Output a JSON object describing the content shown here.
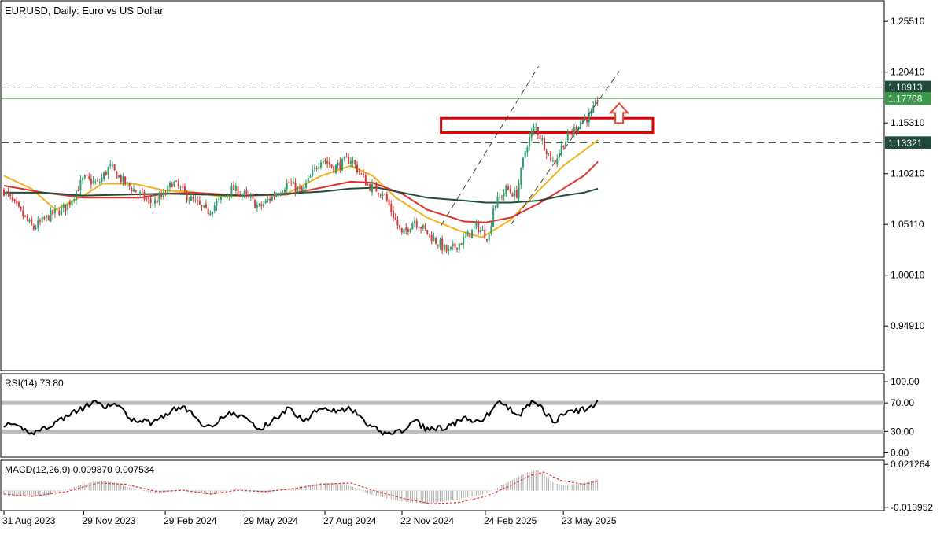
{
  "colors": {
    "background": "#ffffff",
    "frame": "#000000",
    "candle_up": "#2e9e6e",
    "candle_down": "#d43a3a",
    "ma_fast": "#f5b21a",
    "ma_mid": "#e03030",
    "ma_slow": "#1f4b3a",
    "price_line": "#3a9a4a",
    "level_line": "#1f4b3a",
    "channel": "#444444",
    "zone": "#e00000",
    "arrow": "#e04830",
    "rsi_line": "#000000",
    "rsi_band": "#bdbdbd",
    "macd_hist": "#a8a8a8",
    "macd_signal": "#d43a3a",
    "badge_price": "#3a9a4a",
    "badge_level": "#1f4b3a"
  },
  "chart_data": [
    {
      "type": "candlestick",
      "title": "EURUSD, Daily:  Euro vs US Dollar",
      "ylim": [
        0.905,
        1.275
      ],
      "y_ticks": [
        "1.25510",
        "1.20410",
        "1.15310",
        "1.10210",
        "1.05110",
        "1.00010",
        "0.94910"
      ],
      "x_ticks": [
        "31 Aug 2023",
        "29 Nov 2023",
        "29 Feb 2024",
        "29 May 2024",
        "27 Aug 2024",
        "22 Nov 2024",
        "24 Feb 2025",
        "23 May 2025"
      ],
      "close_path": [
        [
          "2023-08-31",
          1.085
        ],
        [
          "2023-09-15",
          1.067
        ],
        [
          "2023-10-03",
          1.047
        ],
        [
          "2023-10-20",
          1.059
        ],
        [
          "2023-11-10",
          1.069
        ],
        [
          "2023-11-29",
          1.097
        ],
        [
          "2023-12-15",
          1.092
        ],
        [
          "2023-12-28",
          1.109
        ],
        [
          "2024-01-15",
          1.092
        ],
        [
          "2024-02-14",
          1.072
        ],
        [
          "2024-02-29",
          1.081
        ],
        [
          "2024-03-08",
          1.094
        ],
        [
          "2024-03-28",
          1.077
        ],
        [
          "2024-04-16",
          1.063
        ],
        [
          "2024-05-15",
          1.087
        ],
        [
          "2024-05-29",
          1.08
        ],
        [
          "2024-06-14",
          1.068
        ],
        [
          "2024-07-17",
          1.093
        ],
        [
          "2024-08-01",
          1.083
        ],
        [
          "2024-08-23",
          1.118
        ],
        [
          "2024-09-06",
          1.108
        ],
        [
          "2024-09-25",
          1.117
        ],
        [
          "2024-10-15",
          1.09
        ],
        [
          "2024-11-01",
          1.083
        ],
        [
          "2024-11-22",
          1.04
        ],
        [
          "2024-12-06",
          1.056
        ],
        [
          "2024-12-20",
          1.043
        ],
        [
          "2025-01-13",
          1.023
        ],
        [
          "2025-01-31",
          1.036
        ],
        [
          "2025-02-14",
          1.049
        ],
        [
          "2025-02-28",
          1.038
        ],
        [
          "2025-03-05",
          1.069
        ],
        [
          "2025-03-20",
          1.087
        ],
        [
          "2025-03-31",
          1.08
        ],
        [
          "2025-04-11",
          1.13
        ],
        [
          "2025-04-21",
          1.15
        ],
        [
          "2025-05-12",
          1.112
        ],
        [
          "2025-05-23",
          1.133
        ],
        [
          "2025-06-12",
          1.155
        ],
        [
          "2025-06-24",
          1.161
        ],
        [
          "2025-07-01",
          1.178
        ]
      ],
      "moving_averages": [
        {
          "role": "ma_fast",
          "path": [
            [
              "2023-08-31",
              1.1
            ],
            [
              "2023-10-01",
              1.087
            ],
            [
              "2023-10-28",
              1.066
            ],
            [
              "2023-11-29",
              1.08
            ],
            [
              "2023-12-20",
              1.092
            ],
            [
              "2024-01-25",
              1.092
            ],
            [
              "2024-02-29",
              1.085
            ],
            [
              "2024-03-28",
              1.084
            ],
            [
              "2024-05-01",
              1.079
            ],
            [
              "2024-05-29",
              1.08
            ],
            [
              "2024-07-15",
              1.082
            ],
            [
              "2024-08-23",
              1.1
            ],
            [
              "2024-09-25",
              1.11
            ],
            [
              "2024-10-20",
              1.1
            ],
            [
              "2024-11-15",
              1.078
            ],
            [
              "2024-12-20",
              1.058
            ],
            [
              "2025-01-25",
              1.045
            ],
            [
              "2025-02-20",
              1.038
            ],
            [
              "2025-03-25",
              1.056
            ],
            [
              "2025-04-25",
              1.085
            ],
            [
              "2025-05-23",
              1.11
            ],
            [
              "2025-06-15",
              1.125
            ],
            [
              "2025-07-01",
              1.136
            ]
          ]
        },
        {
          "role": "ma_mid",
          "path": [
            [
              "2023-08-31",
              1.09
            ],
            [
              "2023-10-15",
              1.083
            ],
            [
              "2023-11-29",
              1.078
            ],
            [
              "2024-02-01",
              1.078
            ],
            [
              "2024-02-29",
              1.082
            ],
            [
              "2024-04-01",
              1.083
            ],
            [
              "2024-05-29",
              1.08
            ],
            [
              "2024-07-15",
              1.081
            ],
            [
              "2024-08-23",
              1.088
            ],
            [
              "2024-09-25",
              1.094
            ],
            [
              "2024-10-20",
              1.093
            ],
            [
              "2024-11-22",
              1.082
            ],
            [
              "2024-12-20",
              1.066
            ],
            [
              "2025-01-31",
              1.054
            ],
            [
              "2025-02-24",
              1.053
            ],
            [
              "2025-03-25",
              1.058
            ],
            [
              "2025-04-25",
              1.072
            ],
            [
              "2025-05-23",
              1.087
            ],
            [
              "2025-06-15",
              1.1
            ],
            [
              "2025-07-01",
              1.114
            ]
          ]
        },
        {
          "role": "ma_slow",
          "path": [
            [
              "2023-08-31",
              1.083
            ],
            [
              "2023-10-15",
              1.083
            ],
            [
              "2023-11-29",
              1.08
            ],
            [
              "2024-01-15",
              1.081
            ],
            [
              "2024-02-29",
              1.082
            ],
            [
              "2024-04-15",
              1.081
            ],
            [
              "2024-05-29",
              1.08
            ],
            [
              "2024-07-15",
              1.082
            ],
            [
              "2024-08-23",
              1.084
            ],
            [
              "2024-09-25",
              1.087
            ],
            [
              "2024-10-25",
              1.088
            ],
            [
              "2024-11-22",
              1.083
            ],
            [
              "2024-12-20",
              1.078
            ],
            [
              "2025-01-31",
              1.075
            ],
            [
              "2025-02-24",
              1.073
            ],
            [
              "2025-03-25",
              1.073
            ],
            [
              "2025-04-25",
              1.075
            ],
            [
              "2025-05-23",
              1.08
            ],
            [
              "2025-06-15",
              1.083
            ],
            [
              "2025-07-01",
              1.087
            ]
          ]
        }
      ],
      "levels": [
        {
          "role": "upper",
          "value": 1.18913,
          "label": "1.18913",
          "style": "dashed"
        },
        {
          "role": "price",
          "value": 1.17768,
          "label": "1.17768",
          "style": "solid"
        },
        {
          "role": "lower",
          "value": 1.13321,
          "label": "1.13321",
          "style": "dashed"
        }
      ],
      "zone": {
        "from": "2025-01-05",
        "to": "2025-09-01",
        "low": 1.1434,
        "high": 1.1578
      },
      "arrow": {
        "date": "2025-07-25",
        "value": 1.153,
        "direction": "up"
      },
      "channel_lines": [
        [
          [
            "2025-01-05",
            1.05
          ],
          [
            "2025-04-25",
            1.21
          ]
        ],
        [
          [
            "2025-03-25",
            1.051
          ],
          [
            "2025-07-25",
            1.205
          ]
        ]
      ]
    },
    {
      "type": "line",
      "title": "RSI(14) 73.80",
      "ylim": [
        -5,
        110
      ],
      "y_ticks": [
        "100.00",
        "70.00",
        "30.00",
        "0.00"
      ],
      "bands": [
        70,
        30
      ],
      "path": [
        [
          "2023-08-31",
          40
        ],
        [
          "2023-09-20",
          34
        ],
        [
          "2023-10-03",
          28
        ],
        [
          "2023-10-25",
          40
        ],
        [
          "2023-11-10",
          52
        ],
        [
          "2023-11-29",
          63
        ],
        [
          "2023-12-10",
          72
        ],
        [
          "2023-12-20",
          64
        ],
        [
          "2024-01-05",
          68
        ],
        [
          "2024-01-20",
          48
        ],
        [
          "2024-02-14",
          42
        ],
        [
          "2024-03-08",
          60
        ],
        [
          "2024-03-20",
          65
        ],
        [
          "2024-04-16",
          35
        ],
        [
          "2024-05-10",
          55
        ],
        [
          "2024-05-29",
          50
        ],
        [
          "2024-06-14",
          32
        ],
        [
          "2024-07-17",
          62
        ],
        [
          "2024-08-05",
          45
        ],
        [
          "2024-08-23",
          66
        ],
        [
          "2024-09-10",
          58
        ],
        [
          "2024-09-25",
          62
        ],
        [
          "2024-10-15",
          38
        ],
        [
          "2024-11-01",
          28
        ],
        [
          "2024-11-22",
          30
        ],
        [
          "2024-12-06",
          45
        ],
        [
          "2024-12-20",
          33
        ],
        [
          "2025-01-13",
          36
        ],
        [
          "2025-01-31",
          48
        ],
        [
          "2025-02-14",
          42
        ],
        [
          "2025-03-01",
          55
        ],
        [
          "2025-03-10",
          73
        ],
        [
          "2025-03-25",
          60
        ],
        [
          "2025-04-05",
          55
        ],
        [
          "2025-04-21",
          75
        ],
        [
          "2025-05-12",
          42
        ],
        [
          "2025-05-25",
          56
        ],
        [
          "2025-06-12",
          60
        ],
        [
          "2025-06-24",
          64
        ],
        [
          "2025-07-01",
          74
        ]
      ]
    },
    {
      "type": "bar",
      "title": "MACD(12,26,9) 0.009870 0.007534",
      "ylim": [
        -0.016,
        0.024
      ],
      "y_ticks": [
        "0.021264",
        "-0.013952"
      ],
      "histogram": [
        [
          "2023-08-31",
          -0.004
        ],
        [
          "2023-09-25",
          -0.005
        ],
        [
          "2023-10-20",
          -0.004
        ],
        [
          "2023-11-15",
          0.002
        ],
        [
          "2023-12-10",
          0.007
        ],
        [
          "2023-12-25",
          0.008
        ],
        [
          "2024-01-25",
          0.001
        ],
        [
          "2024-02-20",
          -0.003
        ],
        [
          "2024-03-20",
          0.001
        ],
        [
          "2024-04-20",
          -0.004
        ],
        [
          "2024-05-20",
          0.002
        ],
        [
          "2024-06-20",
          -0.002
        ],
        [
          "2024-07-20",
          0.002
        ],
        [
          "2024-08-23",
          0.006
        ],
        [
          "2024-09-20",
          0.005
        ],
        [
          "2024-10-20",
          -0.004
        ],
        [
          "2024-11-20",
          -0.009
        ],
        [
          "2024-12-20",
          -0.011
        ],
        [
          "2025-01-20",
          -0.008
        ],
        [
          "2025-02-24",
          -0.003
        ],
        [
          "2025-03-20",
          0.006
        ],
        [
          "2025-04-10",
          0.014
        ],
        [
          "2025-04-25",
          0.017
        ],
        [
          "2025-05-12",
          0.006
        ],
        [
          "2025-05-25",
          0.004
        ],
        [
          "2025-06-15",
          0.006
        ],
        [
          "2025-07-01",
          0.009
        ]
      ],
      "signal": [
        [
          "2023-08-31",
          -0.003
        ],
        [
          "2023-10-01",
          -0.005
        ],
        [
          "2023-11-10",
          -0.001
        ],
        [
          "2023-12-15",
          0.006
        ],
        [
          "2024-01-15",
          0.005
        ],
        [
          "2024-02-20",
          -0.001
        ],
        [
          "2024-03-20",
          0.0
        ],
        [
          "2024-04-20",
          -0.003
        ],
        [
          "2024-05-20",
          0.0
        ],
        [
          "2024-06-20",
          -0.001
        ],
        [
          "2024-07-20",
          0.001
        ],
        [
          "2024-08-23",
          0.005
        ],
        [
          "2024-09-25",
          0.006
        ],
        [
          "2024-10-25",
          -0.001
        ],
        [
          "2024-11-25",
          -0.007
        ],
        [
          "2024-12-25",
          -0.011
        ],
        [
          "2025-01-25",
          -0.01
        ],
        [
          "2025-02-24",
          -0.005
        ],
        [
          "2025-03-25",
          0.004
        ],
        [
          "2025-04-15",
          0.012
        ],
        [
          "2025-05-01",
          0.015
        ],
        [
          "2025-05-20",
          0.008
        ],
        [
          "2025-06-15",
          0.005
        ],
        [
          "2025-07-01",
          0.0075
        ]
      ]
    }
  ]
}
